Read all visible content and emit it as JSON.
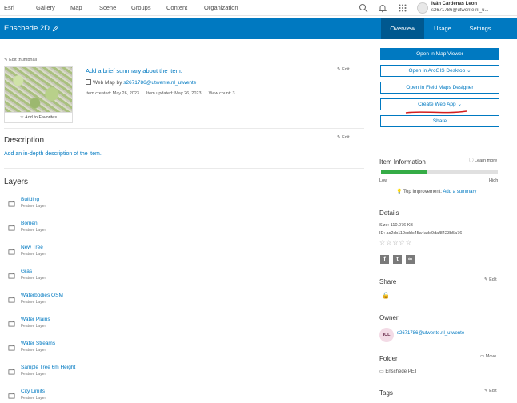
{
  "nav": {
    "items": [
      "Esri",
      "Gallery",
      "Map",
      "Scene",
      "Groups",
      "Content",
      "Organization"
    ],
    "user_name": "Iván Cardenas Leon",
    "user_email": "s2671786@utwente.nl_u..."
  },
  "header": {
    "title": "Enschede 2D",
    "tabs": [
      {
        "label": "Overview",
        "active": true
      },
      {
        "label": "Usage",
        "active": false
      },
      {
        "label": "Settings",
        "active": false
      }
    ]
  },
  "item": {
    "edit_thumbnail": "Edit thumbnail",
    "add_favorites": "Add to Favorites",
    "summary_placeholder": "Add a brief summary about the item.",
    "edit": "Edit",
    "type_prefix": "Web Map by",
    "owner_link": "s2671786@utwente.nl_utwente",
    "created": "Item created: May 26, 2023",
    "updated": "Item updated: May 26, 2023",
    "views": "View count: 3"
  },
  "description": {
    "heading": "Description",
    "placeholder": "Add an in-depth description of the item.",
    "edit": "Edit"
  },
  "layers": {
    "heading": "Layers",
    "items": [
      {
        "name": "Building",
        "type": "Feature Layer"
      },
      {
        "name": "Bomen",
        "type": "Feature Layer"
      },
      {
        "name": "New Tree",
        "type": "Feature Layer"
      },
      {
        "name": "Gras",
        "type": "Feature Layer"
      },
      {
        "name": "Waterbodies OSM",
        "type": "Feature Layer"
      },
      {
        "name": "Water Plains",
        "type": "Feature Layer"
      },
      {
        "name": "Water Streams",
        "type": "Feature Layer"
      },
      {
        "name": "Sample Tree 6m Height",
        "type": "Feature Layer"
      },
      {
        "name": "City Limits",
        "type": "Feature Layer"
      }
    ]
  },
  "actions": {
    "open_map_viewer": "Open in Map Viewer",
    "open_arcgis_desktop": "Open in ArcGIS Desktop",
    "open_field_maps": "Open in Field Maps Designer",
    "create_web_app": "Create Web App",
    "share": "Share"
  },
  "item_info": {
    "heading": "Item Information",
    "learn_more": "Learn more",
    "low": "Low",
    "high": "High",
    "score_fraction": 0.4,
    "top_improvement_label": "Top Improvement:",
    "top_improvement_link": "Add a summary"
  },
  "details": {
    "heading": "Details",
    "size": "Size: 110.076 KB",
    "id": "ID: ac2cb119cddc45a4ade9daf8423b5a76",
    "rating_stars": 0
  },
  "share_section": {
    "heading": "Share",
    "edit": "Edit"
  },
  "owner": {
    "heading": "Owner",
    "initials": "ICL",
    "name": "s2671786@utwente.nl_utwente"
  },
  "folder": {
    "heading": "Folder",
    "move": "Move",
    "name": "Enschede PET"
  },
  "tags": {
    "heading": "Tags",
    "edit": "Edit"
  },
  "colors": {
    "brand_blue": "#0079c1",
    "header_active": "#00588f",
    "progress_green": "#35ac46",
    "annotation_red": "#d32020"
  }
}
